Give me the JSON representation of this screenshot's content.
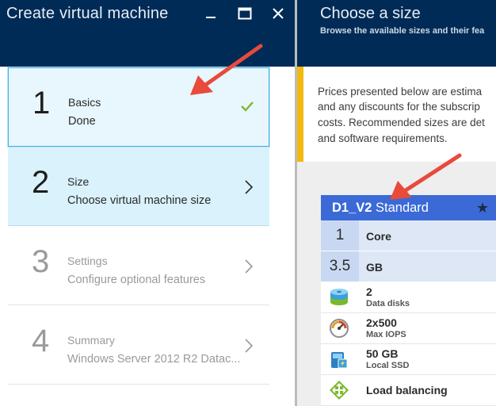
{
  "wizard": {
    "title": "Create virtual machine",
    "steps": [
      {
        "number": "1",
        "label": "Basics",
        "sub": "Done",
        "status": "done"
      },
      {
        "number": "2",
        "label": "Size",
        "sub": "Choose virtual machine size",
        "status": "active"
      },
      {
        "number": "3",
        "label": "Settings",
        "sub": "Configure optional features",
        "status": "pending"
      },
      {
        "number": "4",
        "label": "Summary",
        "sub": "Windows Server 2012 R2 Datac...",
        "status": "pending"
      }
    ]
  },
  "size_blade": {
    "title": "Choose a size",
    "subtitle": "Browse the available sizes and their fea",
    "notice_lines": [
      "Prices presented below are estima",
      "and any discounts for the subscrip",
      "costs. Recommended sizes are det",
      "and software requirements."
    ]
  },
  "size_card": {
    "name": "D1_V2",
    "tier": "Standard",
    "cores_value": "1",
    "cores_unit": "Core",
    "memory_value": "3.5",
    "memory_unit": "GB",
    "features": [
      {
        "value": "2",
        "label": "Data disks",
        "icon": "data-disks-icon"
      },
      {
        "value": "2x500",
        "label": "Max IOPS",
        "icon": "gauge-icon"
      },
      {
        "value": "50 GB",
        "label": "Local SSD",
        "icon": "ssd-icon"
      },
      {
        "value": "Load balancing",
        "label": "",
        "icon": "load-balancer-icon"
      }
    ]
  },
  "colors": {
    "header_bg": "#002b57",
    "active_step_bg": "#d9f2fb",
    "card_header": "#3b6ad7",
    "notice_bar": "#f2b90f",
    "check": "#7cb82f",
    "annotation_arrow": "#e84a3c"
  }
}
